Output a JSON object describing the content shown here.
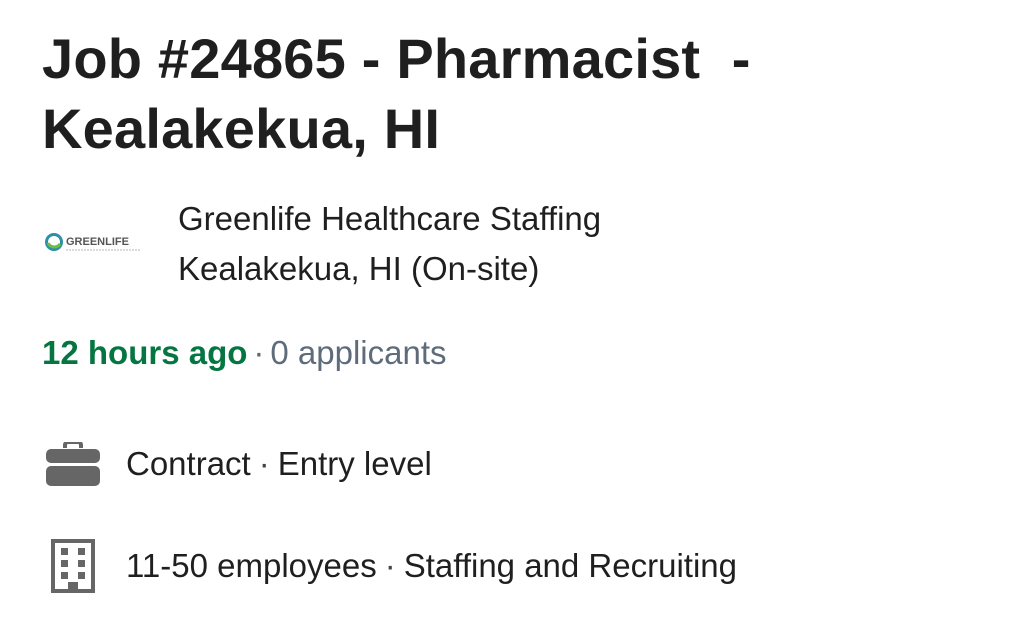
{
  "job": {
    "title": "Job #24865 - Pharmacist  - Kealakekua, HI"
  },
  "company": {
    "logo_text": "GREENLIFE",
    "name": "Greenlife Healthcare Staffing",
    "location": "Kealakekua, HI (On-site)"
  },
  "meta": {
    "posted": "12 hours ago",
    "separator": "·",
    "applicants": "0 applicants"
  },
  "details": {
    "employment_type": "Contract",
    "separator": "·",
    "seniority": "Entry level",
    "company_size": "11-50 employees",
    "industry": "Staffing and Recruiting"
  },
  "icons": {
    "briefcase": "briefcase-icon",
    "building": "building-icon"
  },
  "colors": {
    "posted_green": "#057642",
    "applicants_gray": "#5e6b7a",
    "icon_gray": "#666666"
  }
}
